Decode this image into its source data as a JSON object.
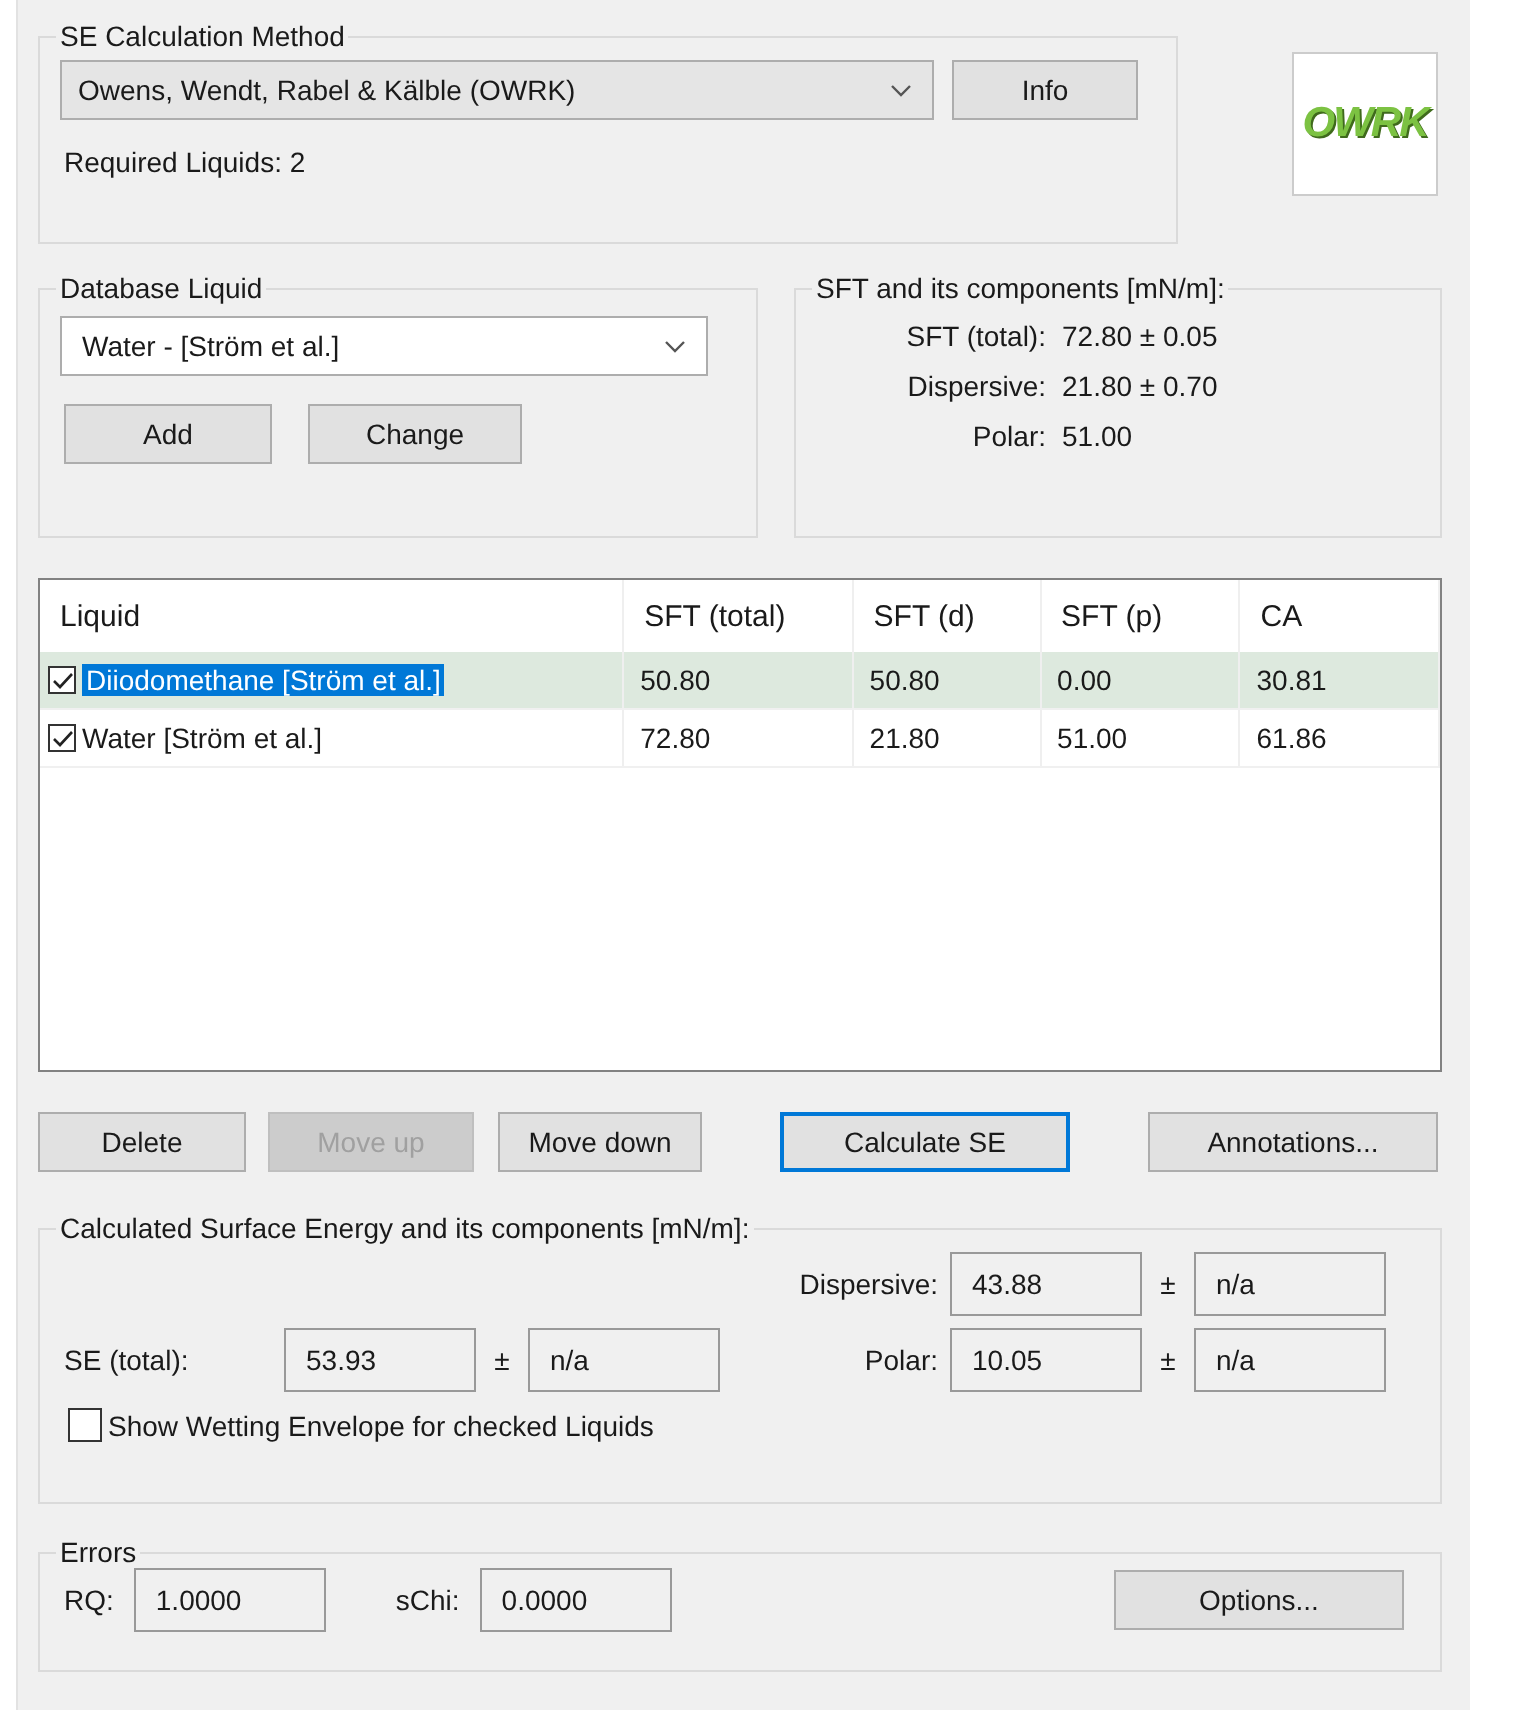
{
  "method_group": {
    "title": "SE Calculation Method",
    "method": "Owens, Wendt, Rabel & Kälble (OWRK)",
    "info_button": "Info",
    "required_liquids": "Required Liquids: 2"
  },
  "logo": {
    "text": "OWRK"
  },
  "database_group": {
    "title": "Database Liquid",
    "liquid": "Water - [Ström et al.]",
    "buttons": [
      "Add",
      "Change"
    ]
  },
  "sft_group": {
    "title": "SFT and its components [mN/m]:",
    "rows": [
      {
        "label": "SFT (total):",
        "value": "72.80 ± 0.05"
      },
      {
        "label": "Dispersive:",
        "value": "21.80 ± 0.70"
      },
      {
        "label": "Polar:",
        "value": "51.00"
      }
    ]
  },
  "table": {
    "columns": [
      "Liquid",
      "SFT (total)",
      "SFT (d)",
      "SFT (p)",
      "CA"
    ],
    "rows": [
      {
        "checked": true,
        "selected": true,
        "cells": [
          "Diiodomethane [Ström et al.]",
          "50.80",
          "50.80",
          "0.00",
          "30.81"
        ]
      },
      {
        "checked": true,
        "selected": false,
        "cells": [
          "Water [Ström et al.]",
          "72.80",
          "21.80",
          "51.00",
          "61.86"
        ]
      }
    ]
  },
  "actions": [
    {
      "label": "Delete",
      "disabled": false,
      "focused": false
    },
    {
      "label": "Move up",
      "disabled": true,
      "focused": false
    },
    {
      "label": "Move down",
      "disabled": false,
      "focused": false
    },
    {
      "label": "Calculate SE",
      "disabled": false,
      "focused": true
    },
    {
      "label": "Annotations...",
      "disabled": false,
      "focused": false
    }
  ],
  "result_group": {
    "title": "Calculated Surface Energy and its components [mN/m]:",
    "total": {
      "label": "SE (total):",
      "value": "53.93",
      "sign": "±",
      "error": "n/a"
    },
    "components": [
      {
        "label": "Dispersive:",
        "value": "43.88",
        "sign": "±",
        "error": "n/a"
      },
      {
        "label": "Polar:",
        "value": "10.05",
        "sign": "±",
        "error": "n/a"
      }
    ],
    "wetting_envelope": {
      "label": "Show Wetting Envelope for checked Liquids",
      "checked": false
    }
  },
  "errors_group": {
    "title": "Errors",
    "fields": [
      {
        "label": "RQ:",
        "value": "1.0000"
      },
      {
        "label": "sChi:",
        "value": "0.0000"
      }
    ],
    "options_button": "Options..."
  }
}
